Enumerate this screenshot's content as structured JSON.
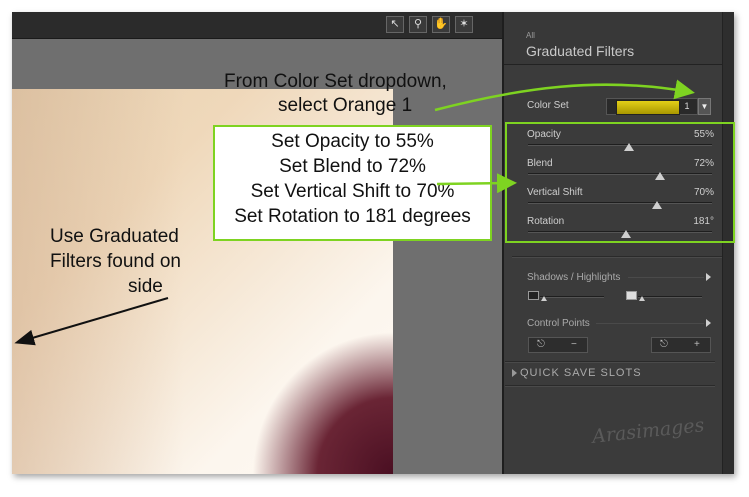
{
  "panel": {
    "small_label": "All",
    "title": "Graduated Filters",
    "color_set": {
      "label": "Color Set",
      "value": "1",
      "swatch_color": "#d4c000"
    },
    "sliders": [
      {
        "label": "Opacity",
        "value": "55%",
        "fraction": 0.55
      },
      {
        "label": "Blend",
        "value": "72%",
        "fraction": 0.72
      },
      {
        "label": "Vertical Shift",
        "value": "70%",
        "fraction": 0.7
      },
      {
        "label": "Rotation",
        "value": "181°",
        "fraction": 0.53
      }
    ],
    "shadows_highlights": {
      "label": "Shadows / Highlights"
    },
    "control_points": {
      "label": "Control Points",
      "minus": "−",
      "plus": "+"
    },
    "quick_save": {
      "label": "QUICK SAVE SLOTS"
    }
  },
  "annotations": {
    "dropdown_line1": "From Color Set dropdown,",
    "dropdown_line2": "select Orange 1",
    "settings": [
      "Set Opacity to 55%",
      "Set Blend to 72%",
      "Set Vertical Shift to 70%",
      "Set Rotation to 181 degrees"
    ],
    "side_line1": "Use Graduated",
    "side_line2": "Filters found on",
    "side_line3": "side"
  },
  "watermark": "Arasimages",
  "colors": {
    "highlight": "#7ed321",
    "panel_bg": "#3b3b3b"
  }
}
